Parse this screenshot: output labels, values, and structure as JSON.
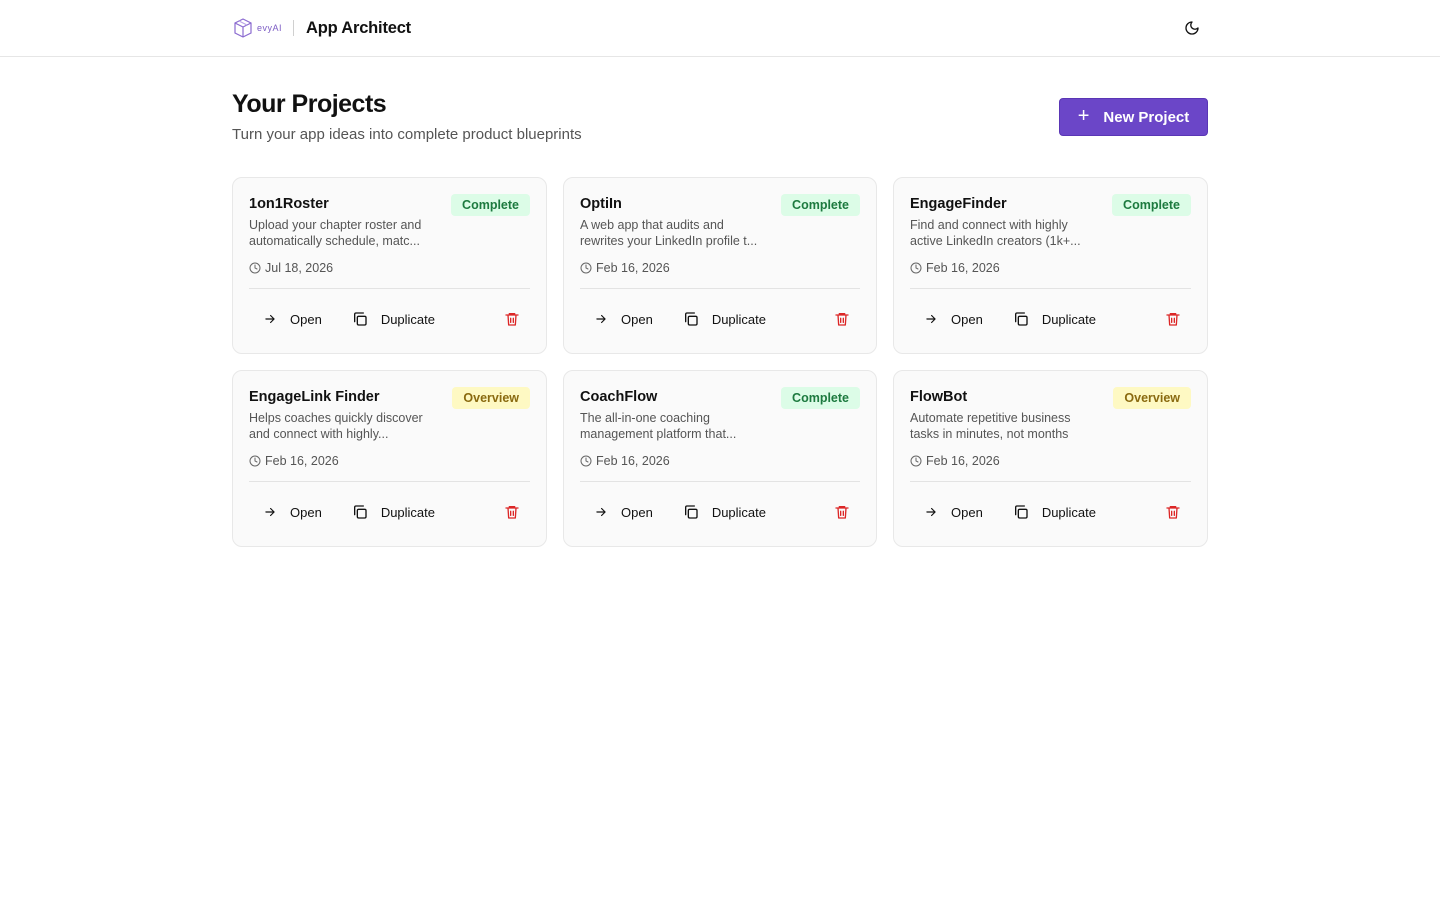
{
  "header": {
    "logo_text": "evyAI",
    "app_title": "App Architect",
    "theme_icon": "moon-icon"
  },
  "page": {
    "title": "Your Projects",
    "subtitle": "Turn your app ideas into complete product blueprints",
    "new_project_label": "New Project"
  },
  "colors": {
    "accent": "#6b46c8",
    "complete_bg": "#dcfce7",
    "complete_text": "#1d7a3f",
    "overview_bg": "#fef9c3",
    "overview_text": "#8a6a10",
    "delete": "#dc2626"
  },
  "actions": {
    "open_label": "Open",
    "duplicate_label": "Duplicate"
  },
  "projects": [
    {
      "name": "1on1Roster",
      "status": "Complete",
      "status_key": "complete",
      "desc1": "Upload your chapter roster and",
      "desc2": "automatically schedule, matc...",
      "date": "Jul 18, 2026"
    },
    {
      "name": "OptiIn",
      "status": "Complete",
      "status_key": "complete",
      "desc1": "A web app that audits and",
      "desc2": "rewrites your LinkedIn profile t...",
      "date": "Feb 16, 2026"
    },
    {
      "name": "EngageFinder",
      "status": "Complete",
      "status_key": "complete",
      "desc1": "Find and connect with highly",
      "desc2": "active LinkedIn creators (1k+...",
      "date": "Feb 16, 2026"
    },
    {
      "name": "EngageLink Finder",
      "status": "Overview",
      "status_key": "overview",
      "desc1": "Helps coaches quickly discover",
      "desc2": "and connect with highly...",
      "date": "Feb 16, 2026"
    },
    {
      "name": "CoachFlow",
      "status": "Complete",
      "status_key": "complete",
      "desc1": "The all-in-one coaching",
      "desc2": "management platform that...",
      "date": "Feb 16, 2026"
    },
    {
      "name": "FlowBot",
      "status": "Overview",
      "status_key": "overview",
      "desc1": "Automate repetitive business",
      "desc2": "tasks in minutes, not months",
      "date": "Feb 16, 2026"
    }
  ]
}
